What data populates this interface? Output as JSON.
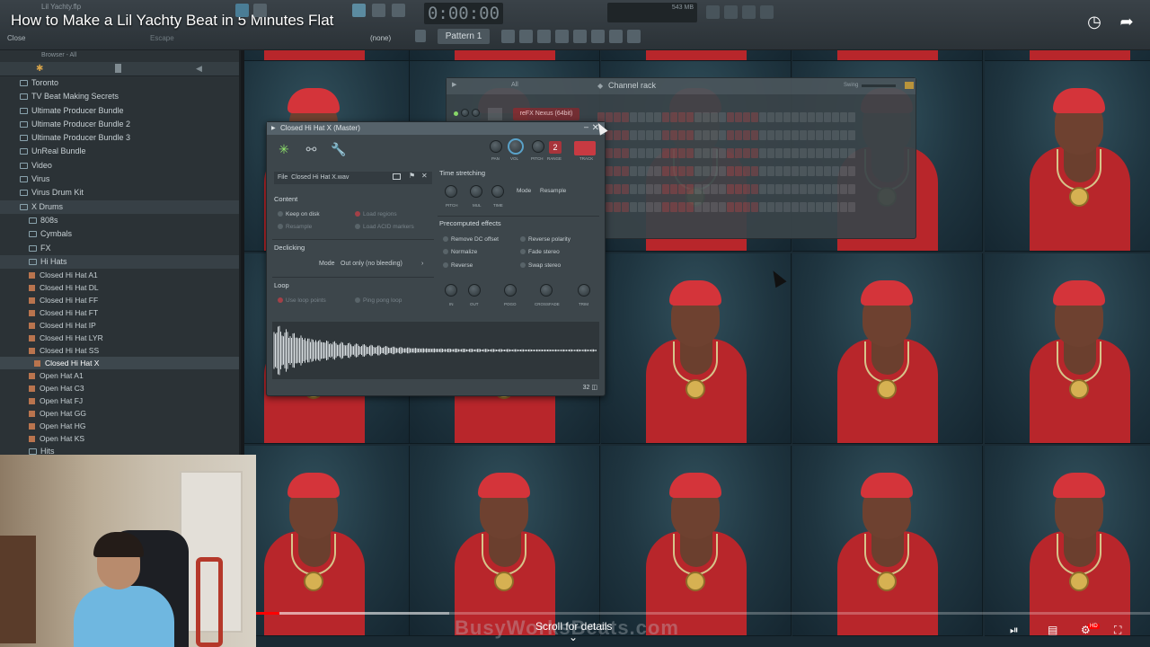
{
  "video": {
    "title": "How to Make a Lil Yachty Beat in 5 Minutes Flat",
    "scroll_hint": "Scroll for details",
    "watermark": "BusyWorksBeats.com",
    "progress_percent": 2.6,
    "buffered_percent": 21.6
  },
  "fl": {
    "project_name": "Lil Yachty.flp",
    "hint_action": "Close",
    "hint_key": "Escape",
    "time": "0:00:00",
    "pattern": "Pattern 1",
    "none_label": "(none)",
    "memory": "543 MB"
  },
  "browser": {
    "header": "Browser - All",
    "items": [
      {
        "label": "Toronto",
        "type": "folder",
        "depth": 0
      },
      {
        "label": "TV Beat Making Secrets",
        "type": "folder",
        "depth": 0
      },
      {
        "label": "Ultimate Producer Bundle",
        "type": "folder",
        "depth": 0
      },
      {
        "label": "Ultimate Producer Bundle 2",
        "type": "folder",
        "depth": 0
      },
      {
        "label": "Ultimate Producer Bundle 3",
        "type": "folder",
        "depth": 0
      },
      {
        "label": "UnReal Bundle",
        "type": "folder",
        "depth": 0
      },
      {
        "label": "Video",
        "type": "folder",
        "depth": 0
      },
      {
        "label": "Virus",
        "type": "folder",
        "depth": 0
      },
      {
        "label": "Virus Drum Kit",
        "type": "folder",
        "depth": 0
      },
      {
        "label": "X Drums",
        "type": "folder",
        "depth": 0,
        "open": true
      },
      {
        "label": "808s",
        "type": "folder",
        "depth": 1
      },
      {
        "label": "Cymbals",
        "type": "folder",
        "depth": 1
      },
      {
        "label": "FX",
        "type": "folder",
        "depth": 1
      },
      {
        "label": "Hi Hats",
        "type": "folder",
        "depth": 1,
        "open": true
      },
      {
        "label": "Closed Hi Hat A1",
        "type": "file",
        "depth": 2
      },
      {
        "label": "Closed Hi Hat DL",
        "type": "file",
        "depth": 2
      },
      {
        "label": "Closed Hi Hat FF",
        "type": "file",
        "depth": 2
      },
      {
        "label": "Closed Hi Hat FT",
        "type": "file",
        "depth": 2
      },
      {
        "label": "Closed Hi Hat IP",
        "type": "file",
        "depth": 2
      },
      {
        "label": "Closed Hi Hat LYR",
        "type": "file",
        "depth": 2
      },
      {
        "label": "Closed Hi Hat SS",
        "type": "file",
        "depth": 2
      },
      {
        "label": "Closed Hi Hat X",
        "type": "file",
        "depth": 2,
        "selected": true
      },
      {
        "label": "Open Hat A1",
        "type": "file",
        "depth": 2
      },
      {
        "label": "Open Hat C3",
        "type": "file",
        "depth": 2
      },
      {
        "label": "Open Hat FJ",
        "type": "file",
        "depth": 2
      },
      {
        "label": "Open Hat GG",
        "type": "file",
        "depth": 2
      },
      {
        "label": "Open Hat HG",
        "type": "file",
        "depth": 2
      },
      {
        "label": "Open Hat KS",
        "type": "file",
        "depth": 2
      },
      {
        "label": "Hits",
        "type": "folder",
        "depth": 1
      }
    ]
  },
  "channel_rack": {
    "title": "Channel rack",
    "filter": "All",
    "swing_label": "Swing",
    "channel_name": "reFX Nexus (64bit)"
  },
  "sampler": {
    "title": "Closed Hi Hat X (Master)",
    "knob_labels": {
      "pan": "PAN",
      "vol": "VOL",
      "pitch": "PITCH",
      "range": "RANGE",
      "track": "TRACK"
    },
    "pitch_badge": "2",
    "file_label": "File",
    "file_value": "Closed Hi Hat X.wav",
    "content": {
      "title": "Content",
      "keep_on_disk": "Keep on disk",
      "load_regions": "Load regions",
      "resample": "Resample",
      "load_acid": "Load ACID markers"
    },
    "declicking": {
      "title": "Declicking",
      "mode_label": "Mode",
      "mode_value": "Out only (no bleeding)"
    },
    "loop": {
      "title": "Loop",
      "use_loop_points": "Use loop points",
      "ping_pong": "Ping pong loop"
    },
    "time_stretching": {
      "title": "Time stretching",
      "knobs": {
        "pitch": "PITCH",
        "mul": "MUL",
        "time": "TIME"
      },
      "mode_label": "Mode",
      "mode_value": "Resample"
    },
    "precomputed": {
      "title": "Precomputed effects",
      "remove_dc": "Remove DC offset",
      "reverse_polarity": "Reverse polarity",
      "normalize": "Normalize",
      "fade_stereo": "Fade stereo",
      "reverse": "Reverse",
      "swap_stereo": "Swap stereo",
      "knobs": {
        "in": "IN",
        "out": "OUT",
        "pogo": "POGO",
        "crossfade": "CROSSFADE",
        "trim": "TRIM"
      }
    },
    "zoom_readout": "32"
  },
  "icons": [
    "sampler-wave-icon",
    "envelope-icon",
    "wrench-icon",
    "folder-icon",
    "close-icon",
    "clock-icon",
    "share-icon",
    "play-icon"
  ]
}
